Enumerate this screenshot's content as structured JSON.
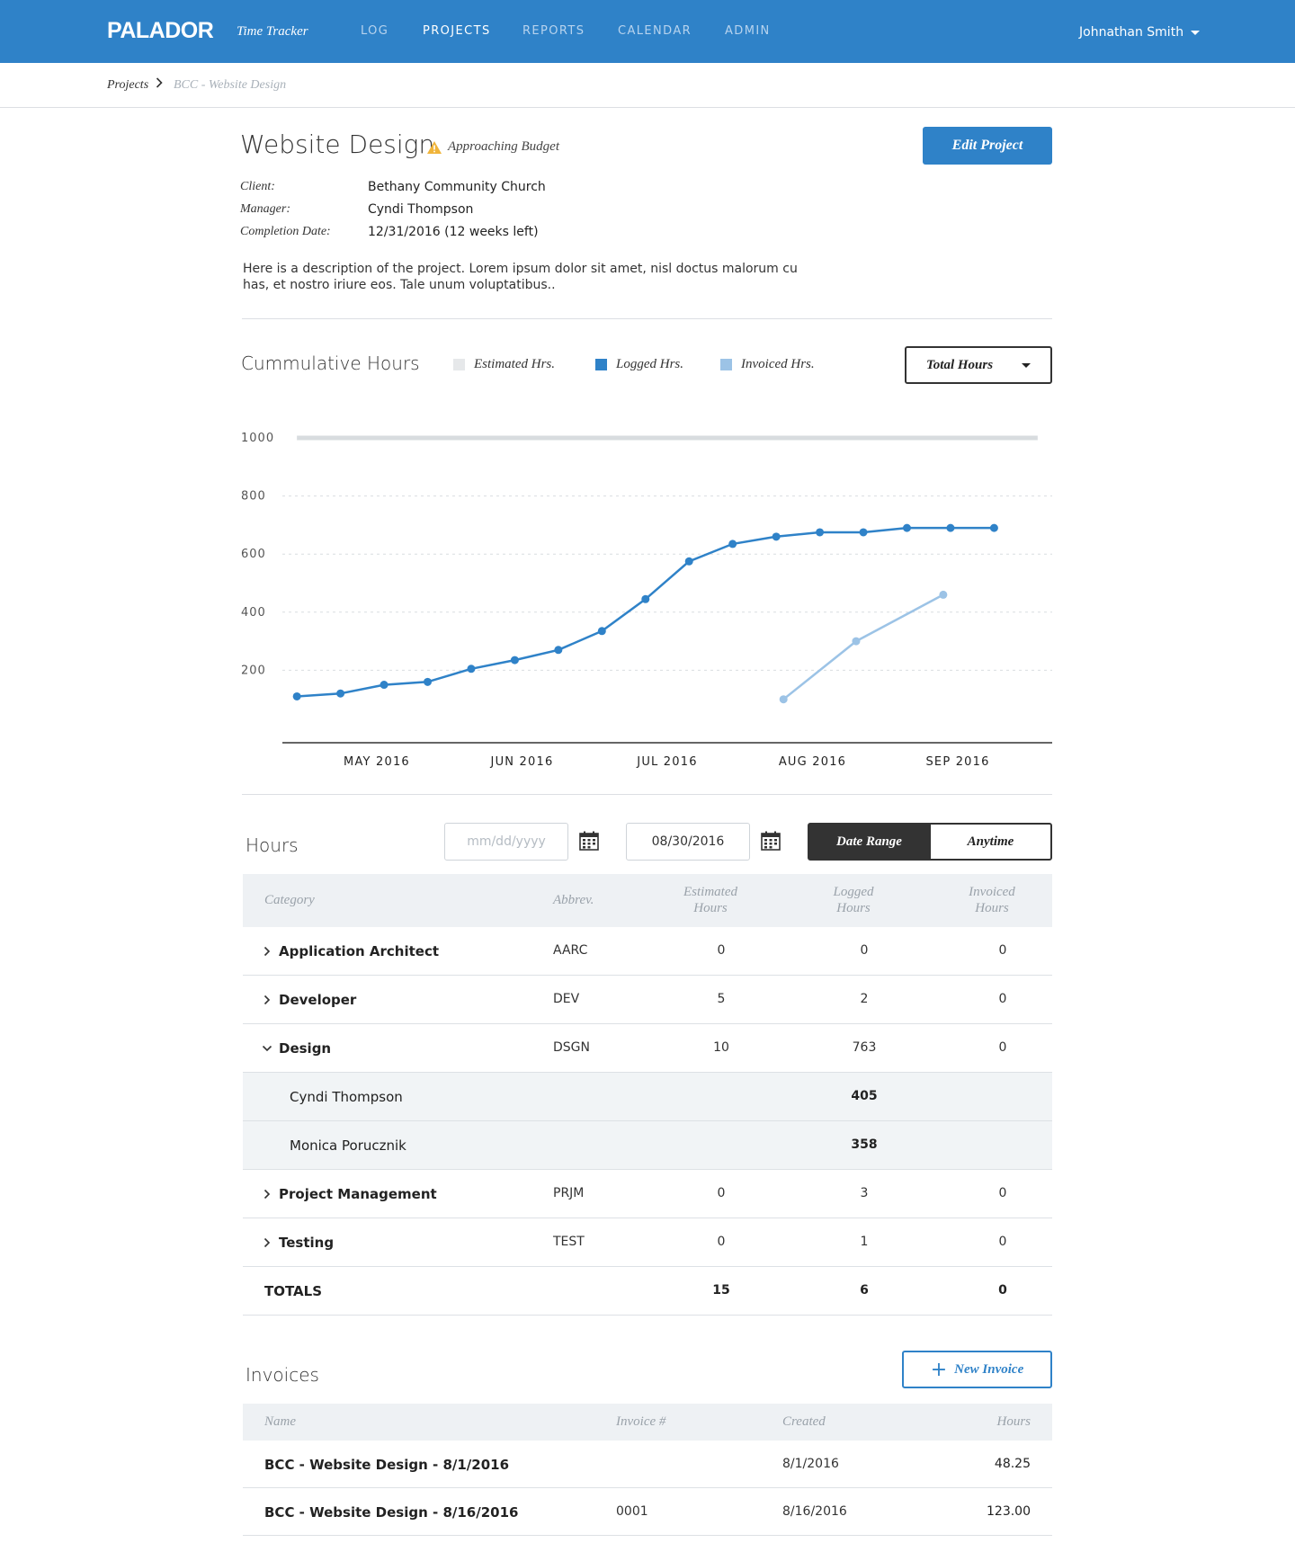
{
  "brand": {
    "logo": "PALADOR",
    "app": "Time Tracker"
  },
  "nav": {
    "log": "LOG",
    "projects": "PROJECTS",
    "reports": "REPORTS",
    "calendar": "CALENDAR",
    "admin": "ADMIN"
  },
  "user": {
    "name": "Johnathan Smith"
  },
  "breadcrumb": {
    "root": "Projects",
    "current": "BCC - Website Design"
  },
  "project": {
    "title": "Website Design",
    "status": "Approaching Budget",
    "edit_label": "Edit Project",
    "client_label": "Client:",
    "client": "Bethany Community Church",
    "manager_label": "Manager:",
    "manager": "Cyndi Thompson",
    "completion_label": "Completion Date:",
    "completion": "12/31/2016 (12 weeks left)",
    "description": "Here is a description of the project. Lorem ipsum dolor sit amet, nisl doctus malorum cu has, et nostro iriure eos. Tale unum voluptatibus.."
  },
  "chart_section": {
    "title": "Cummulative Hours",
    "legend": {
      "estimated": "Estimated Hrs.",
      "logged": "Logged Hrs.",
      "invoiced": "Invoiced Hrs."
    },
    "select_label": "Total Hours"
  },
  "colors": {
    "accent": "#2f82c8",
    "invoiced": "#9cc3e6",
    "estimated": "#d8dcdf",
    "header_bar": "#2f82c8"
  },
  "chart_data": {
    "type": "line",
    "ylim": [
      0,
      1000
    ],
    "y_ticks": [
      200,
      400,
      600,
      800,
      1000
    ],
    "x_ticks": [
      "MAY 2016",
      "JUN 2016",
      "JUL 2016",
      "AUG 2016",
      "SEP 2016"
    ],
    "x_tick_positions": [
      2.55,
      3.55,
      4.55,
      5.55,
      6.55
    ],
    "grid": true,
    "series": [
      {
        "name": "Estimated Hrs.",
        "x": [
          2.0,
          7.1
        ],
        "values": [
          1000,
          1000
        ]
      },
      {
        "name": "Logged Hrs.",
        "x": [
          2.0,
          2.3,
          2.6,
          2.9,
          3.2,
          3.5,
          3.8,
          4.1,
          4.4,
          4.7,
          5.0,
          5.3,
          5.6,
          5.9,
          6.2,
          6.5,
          6.8
        ],
        "values": [
          110,
          120,
          150,
          160,
          205,
          235,
          270,
          335,
          445,
          575,
          635,
          660,
          675,
          675,
          690,
          690,
          690
        ]
      },
      {
        "name": "Invoiced Hrs.",
        "x": [
          5.35,
          5.85,
          6.45
        ],
        "values": [
          100,
          300,
          460
        ]
      }
    ]
  },
  "hours": {
    "title": "Hours",
    "from_placeholder": "mm/dd/yyyy",
    "to_value": "08/30/2016",
    "date_range_label": "Date Range",
    "anytime_label": "Anytime",
    "headers": {
      "category": "Category",
      "abbrev": "Abbrev.",
      "estimated": "Estimated Hours",
      "logged": "Logged Hours",
      "invoiced": "Invoiced Hours"
    },
    "rows": [
      {
        "name": "Application Architect",
        "abbrev": "AARC",
        "estimated": "0",
        "logged": "0",
        "invoiced": "0"
      },
      {
        "name": "Developer",
        "abbrev": "DEV",
        "estimated": "5",
        "logged": "2",
        "invoiced": "0"
      },
      {
        "name": "Design",
        "abbrev": "DSGN",
        "estimated": "10",
        "logged": "763",
        "invoiced": "0"
      },
      {
        "name": "Project Management",
        "abbrev": "PRJM",
        "estimated": "0",
        "logged": "3",
        "invoiced": "0"
      },
      {
        "name": "Testing",
        "abbrev": "TEST",
        "estimated": "0",
        "logged": "1",
        "invoiced": "0"
      }
    ],
    "design_members": [
      {
        "name": "Cyndi Thompson",
        "logged": "405"
      },
      {
        "name": "Monica Porucznik",
        "logged": "358"
      }
    ],
    "totals": {
      "label": "TOTALS",
      "estimated": "15",
      "logged": "6",
      "invoiced": "0"
    }
  },
  "invoices": {
    "title": "Invoices",
    "new_label": "New Invoice",
    "headers": {
      "name": "Name",
      "number": "Invoice #",
      "created": "Created",
      "hours": "Hours"
    },
    "rows": [
      {
        "name": "BCC - Website Design - 8/1/2016",
        "number": "",
        "created": "8/1/2016",
        "hours": "48.25"
      },
      {
        "name": "BCC - Website Design - 8/16/2016",
        "number": "0001",
        "created": "8/16/2016",
        "hours": "123.00"
      }
    ]
  }
}
